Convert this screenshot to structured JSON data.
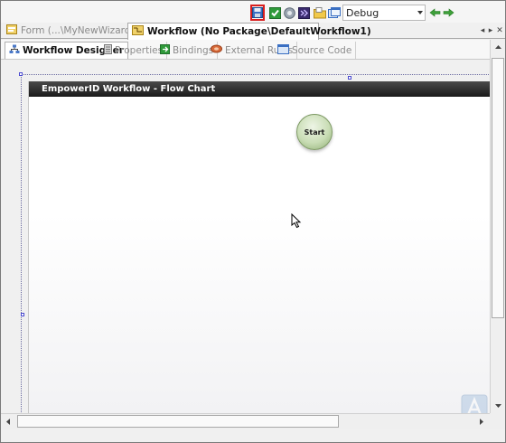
{
  "toolbar": {
    "icons": [
      "save-icon",
      "check-icon",
      "circle-icon",
      "visual-studio-icon",
      "folder-icon",
      "window-icon"
    ],
    "configuration": "Debug",
    "nav": [
      "back-arrow-icon",
      "forward-arrow-icon"
    ]
  },
  "document_tabs": [
    {
      "label": "Form (...\\MyNewWizardForm)",
      "active": false
    },
    {
      "label": "Workflow (No Package\\DefaultWorkflow1)",
      "active": true
    }
  ],
  "designer_tabs": [
    {
      "label": "Workflow Designer",
      "active": true
    },
    {
      "label": "Properties",
      "active": false
    },
    {
      "label": "Bindings",
      "active": false
    },
    {
      "label": "External Rules",
      "active": false
    },
    {
      "label": "Source Code",
      "active": false
    }
  ],
  "flow_chart": {
    "header": "EmpowerID Workflow - Flow Chart",
    "start_node": "Start"
  },
  "colors": {
    "highlight": "#d81e1e",
    "header_bg": "#1a1a1a",
    "start_node": "#c9ddb5"
  }
}
